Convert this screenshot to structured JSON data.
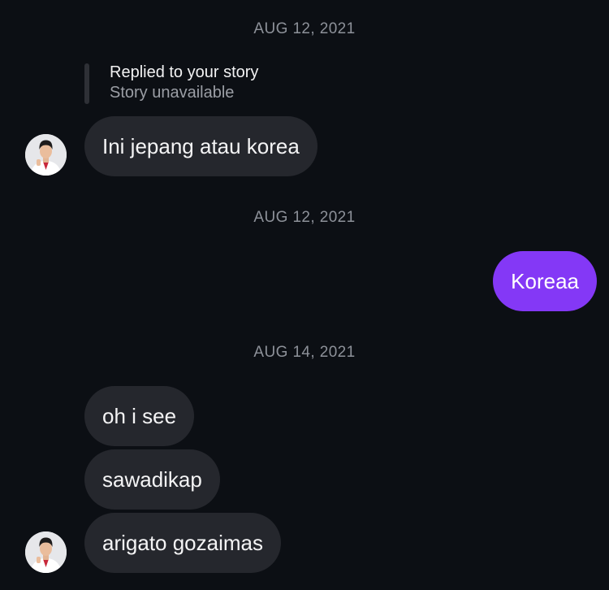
{
  "thread": {
    "dates": [
      "AUG 12, 2021",
      "AUG 12, 2021",
      "AUG 14, 2021"
    ],
    "story_reply": {
      "title": "Replied to your story",
      "status": "Story unavailable"
    },
    "messages": [
      {
        "sender": "them",
        "text": "Ini jepang atau korea"
      },
      {
        "sender": "me",
        "text": "Koreaa"
      },
      {
        "sender": "them",
        "text": "oh i see"
      },
      {
        "sender": "them",
        "text": "sawadikap"
      },
      {
        "sender": "them",
        "text": "arigato gozaimas"
      }
    ]
  },
  "colors": {
    "background": "#0c0f14",
    "incoming_bubble": "#25272d",
    "outgoing_bubble": "#8438f6",
    "timestamp": "#8d9199"
  }
}
